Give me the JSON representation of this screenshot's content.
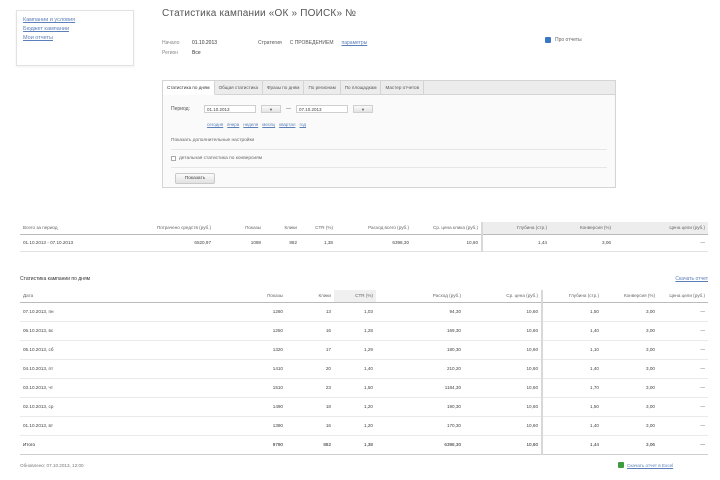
{
  "nav": {
    "links": [
      "Кампании и условия",
      "Бюджет кампании",
      "Мои отчеты"
    ]
  },
  "page": {
    "title": "Статистика кампании «ОК            » ПОИСК» №"
  },
  "meta": {
    "rows": [
      {
        "k": "Начало",
        "v": "01.10.2013"
      },
      {
        "k": "Регион",
        "v": "Все"
      }
    ],
    "strategy_label": "Стратегия",
    "strategy_value": "С ПРОВЕДЕНИЕМ",
    "strategy_link": "параметры"
  },
  "help": {
    "label": "Про отчеты"
  },
  "filter": {
    "tabs": [
      "Статистика по дням",
      "Общая статистика",
      "Фразы по дням",
      "По регионам",
      "По площадкам",
      "Мастер отчетов"
    ],
    "period_label": "Период:",
    "date_from": "01.10.2013",
    "date_to": "07.10.2013",
    "cal_btn": "▾",
    "dash": "—",
    "quick_links": [
      "сегодня",
      "вчера",
      "неделя",
      "месяц",
      "квартал",
      "год"
    ],
    "extra_label": "Показать дополнительные настройки",
    "checkbox_label": "детальная статистика по конверсиям",
    "show_btn": "Показать"
  },
  "summary": {
    "headers": [
      "Всего за период",
      "Потрачено средств (руб.)",
      "Показы",
      "Клики",
      "CTR (%)",
      "Расход всего (руб.)",
      "Ср. цена клика (руб.)",
      "Глубина (стр.)",
      "Конверсия (%)",
      "Цена цели (руб.)"
    ],
    "row": [
      "01.10.2013 - 07.10.2013",
      "6520,97",
      "1098",
      "882",
      "1,38",
      "6398,30",
      "10,60",
      "1,44",
      "3,06",
      "—"
    ]
  },
  "daily": {
    "title": "Статистика кампании по дням",
    "export": "Скачать отчет",
    "headers": [
      "Дата",
      "Показы",
      "Клики",
      "CTR (%)",
      "Расход (руб.)",
      "Ср. цена (руб.)",
      "Глубина (стр.)",
      "Конверсия (%)",
      "Цена цели (руб.)"
    ],
    "rows": [
      [
        "07.10.2013, пн",
        "1260",
        "13",
        "1,03",
        "94,30",
        "10,60",
        "1,50",
        "3,00",
        "—"
      ],
      [
        "06.10.2013, вс",
        "1250",
        "16",
        "1,28",
        "169,30",
        "10,60",
        "1,40",
        "3,00",
        "—"
      ],
      [
        "05.10.2013, сб",
        "1320",
        "17",
        "1,29",
        "180,30",
        "10,60",
        "1,10",
        "3,00",
        "—"
      ],
      [
        "04.10.2013, пт",
        "1410",
        "20",
        "1,40",
        "210,20",
        "10,60",
        "1,40",
        "3,00",
        "—"
      ],
      [
        "03.10.2013, чт",
        "1510",
        "23",
        "1,50",
        "1184,30",
        "10,60",
        "1,70",
        "3,00",
        "—"
      ],
      [
        "02.10.2013, ср",
        "1490",
        "18",
        "1,20",
        "190,30",
        "10,60",
        "1,50",
        "3,00",
        "—"
      ],
      [
        "01.10.2013, вт",
        "1390",
        "16",
        "1,20",
        "170,30",
        "10,60",
        "1,40",
        "3,00",
        "—"
      ]
    ],
    "total": [
      "Итого",
      "9790",
      "882",
      "1,38",
      "6398,30",
      "10,60",
      "1,44",
      "3,06",
      "—"
    ]
  },
  "footer": {
    "updated": "Обновлено: 07.10.2013, 12:00",
    "download": "Скачать отчет в Excel"
  }
}
